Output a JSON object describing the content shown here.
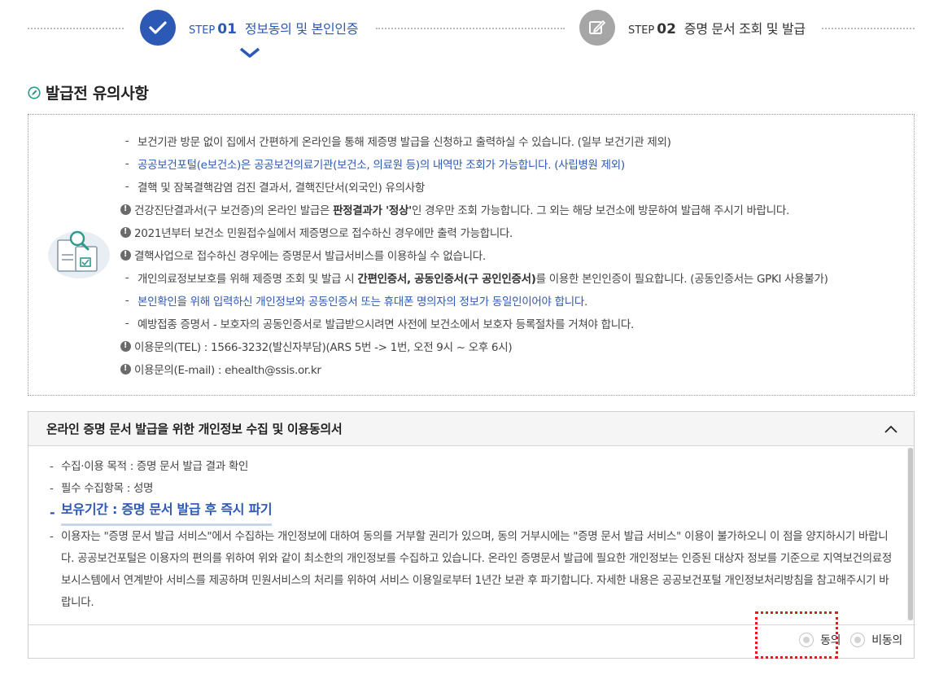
{
  "stepper": {
    "step1": {
      "prefix": "STEP",
      "num": "01",
      "title": "정보동의 및 본인인증",
      "color": "#2c58b6"
    },
    "step2": {
      "prefix": "STEP",
      "num": "02",
      "title": "증명 문서 조회 및 발급",
      "color": "#a6a6a6"
    }
  },
  "section": {
    "title": "발급전 유의사항"
  },
  "notices": [
    {
      "mark": "-",
      "html": "보건기관 방문 없이 집에서 간편하게 온라인을 통해 제증명 발급을 신청하고 출력하실 수 있습니다. (일부 보건기관 제외)"
    },
    {
      "mark": "-",
      "blue": "공공보건포털(e보건소)은 공공보건의료기관(보건소, 의료원 등)의 내역만 조회가 가능합니다. (사립병원 제외)"
    },
    {
      "mark": "-",
      "html": "결핵 및 잠복결핵감염 검진 결과서, 결핵진단서(외국인) 유의사항"
    },
    {
      "mark": "!",
      "pre": "건강진단결과서(구 보건증)의 온라인 발급은 ",
      "bold": "판정결과가 '정상'",
      "post": "인 경우만 조회 가능합니다. 그 외는 해당 보건소에 방문하여 발급해 주시기 바랍니다."
    },
    {
      "mark": "!",
      "html": "2021년부터 보건소 민원접수실에서 제증명으로 접수하신 경우에만 출력 가능합니다."
    },
    {
      "mark": "!",
      "html": "결핵사업으로 접수하신 경우에는 증명문서 발급서비스를 이용하실 수 없습니다."
    },
    {
      "mark": "-",
      "pre": "개인의료정보보호를 위해 제증명 조회 및 발급 시 ",
      "bold": "간편인증서, 공동인증서(구 공인인증서)",
      "post": "를 이용한 본인인증이 필요합니다. (공동인증서는 GPKI 사용불가)"
    },
    {
      "mark": "-",
      "blue": "본인확인을 위해 입력하신 개인정보와 공동인증서 또는 휴대폰 명의자의 정보가 동일인이어야 합니다."
    },
    {
      "mark": "-",
      "html": "예방접종 증명서 - 보호자의 공동인증서로 발급받으시려면 사전에 보건소에서 보호자 등록절차를 거쳐야 합니다."
    },
    {
      "mark": "!",
      "html": "이용문의(TEL) : 1566-3232(발신자부담)(ARS 5번 -> 1번, 오전 9시 ~ 오후 6시)"
    },
    {
      "mark": "!",
      "html": "이용문의(E-mail) : ehealth@ssis.or.kr"
    }
  ],
  "consent": {
    "title": "온라인 증명 문서 발급을 위한 개인정보 수집 및 이용동의서",
    "items": [
      "수집·이용 목적 : 증명 문서 발급 결과 확인",
      "필수 수집항목 : 성명",
      "보유기간 : 증명 문서 발급 후 즉시 파기",
      "이용자는 \"증명 문서 발급 서비스\"에서 수집하는 개인정보에 대하여 동의를 거부할 권리가 있으며, 동의 거부시에는 \"증명 문서 발급 서비스\" 이용이 불가하오니 이 점을 양지하시기 바랍니다. 공공보건포털은 이용자의 편의를 위하여 위와 같이 최소한의 개인정보를 수집하고 있습니다. 온라인 증명문서 발급에 필요한 개인정보는 인증된 대상자 정보를 기준으로 지역보건의료정보시스템에서 연계받아 서비스를 제공하며 민원서비스의 처리를 위하여 서비스 이용일로부터 1년간 보관 후 파기합니다. 자세한 내용은 공공보건포털 개인정보처리방침을 참고해주시기 바랍니다."
    ],
    "agree_label": "동의",
    "disagree_label": "비동의"
  }
}
